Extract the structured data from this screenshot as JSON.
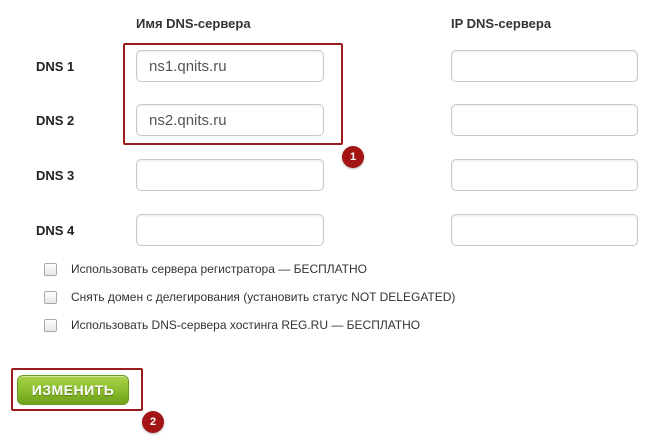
{
  "headers": {
    "name_col": "Имя DNS-сервера",
    "ip_col": "IP DNS-сервера"
  },
  "rows": [
    {
      "label": "DNS 1",
      "name_value": "ns1.qnits.ru",
      "ip_value": ""
    },
    {
      "label": "DNS 2",
      "name_value": "ns2.qnits.ru",
      "ip_value": ""
    },
    {
      "label": "DNS 3",
      "name_value": "",
      "ip_value": ""
    },
    {
      "label": "DNS 4",
      "name_value": "",
      "ip_value": ""
    }
  ],
  "options": [
    {
      "label": "Использовать сервера регистратора — БЕСПЛАТНО",
      "checked": false
    },
    {
      "label": "Снять домен с делегирования (установить статус NOT DELEGATED)",
      "checked": false
    },
    {
      "label": "Использовать DNS-сервера хостинга REG.RU — БЕСПЛАТНО",
      "checked": false
    }
  ],
  "submit_label": "ИЗМЕНИТЬ",
  "annotations": {
    "badge1": "1",
    "badge2": "2"
  },
  "colors": {
    "accent_red": "#9b1c1c",
    "button_green": "#89bb2c"
  }
}
